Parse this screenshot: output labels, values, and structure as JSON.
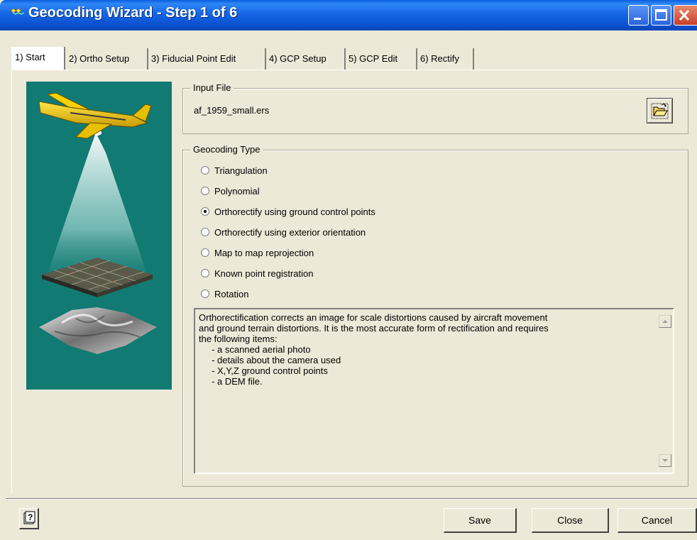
{
  "window": {
    "title": "Geocoding Wizard - Step 1 of 6"
  },
  "tabs": [
    {
      "label": "1) Start",
      "active": true
    },
    {
      "label": "2) Ortho Setup",
      "active": false
    },
    {
      "label": "3) Fiducial Point Edit",
      "active": false
    },
    {
      "label": "4) GCP Setup",
      "active": false
    },
    {
      "label": "5) GCP Edit",
      "active": false
    },
    {
      "label": "6) Rectify",
      "active": false
    }
  ],
  "input_file": {
    "legend": "Input File",
    "filename": "af_1959_small.ers",
    "browse_icon": "open-folder-icon"
  },
  "geocoding_type": {
    "legend": "Geocoding Type",
    "options": [
      {
        "label": "Triangulation",
        "checked": false
      },
      {
        "label": "Polynomial",
        "checked": false
      },
      {
        "label": "Orthorectify using ground control points",
        "checked": true
      },
      {
        "label": "Orthorectify using exterior orientation",
        "checked": false
      },
      {
        "label": "Map to map reprojection",
        "checked": false
      },
      {
        "label": "Known point registration",
        "checked": false
      },
      {
        "label": "Rotation",
        "checked": false
      }
    ]
  },
  "description": "Orthorectification corrects an image for scale distortions caused by aircraft movement\nand ground terrain distortions. It is the most accurate form of rectification and requires\nthe following items:\n     - a scanned aerial photo\n     - details about the camera used\n     - X,Y,Z ground control points\n     - a DEM file.",
  "buttons": {
    "save": "Save",
    "close": "Close",
    "cancel": "Cancel"
  },
  "colors": {
    "titlebar": "#0c52d0",
    "image_pane_bg": "#117a72",
    "dialog_bg": "#ece9d8"
  }
}
